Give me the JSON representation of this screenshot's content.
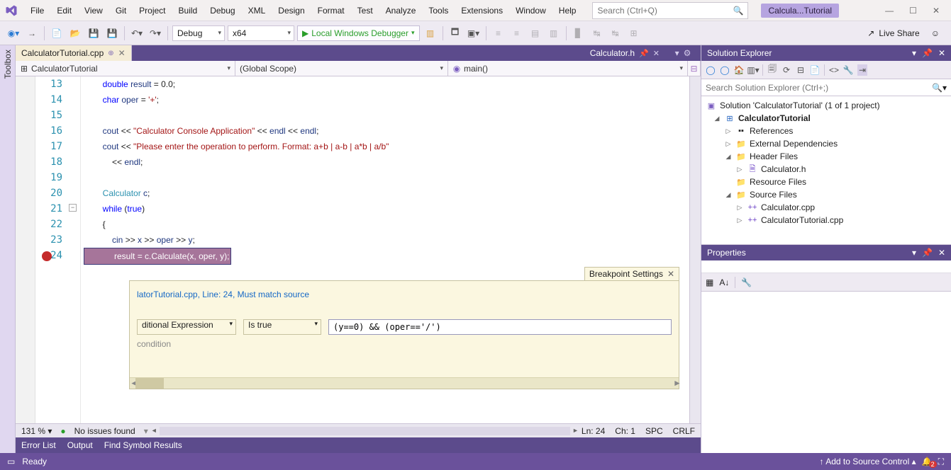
{
  "menu": [
    "File",
    "Edit",
    "View",
    "Git",
    "Project",
    "Build",
    "Debug",
    "XML",
    "Design",
    "Format",
    "Test",
    "Analyze",
    "Tools",
    "Extensions",
    "Window",
    "Help"
  ],
  "search": {
    "placeholder": "Search (Ctrl+Q)"
  },
  "title_badge": "Calcula...Tutorial",
  "toolbar": {
    "config": "Debug",
    "platform": "x64",
    "debugger": "Local Windows Debugger",
    "live_share": "Live Share"
  },
  "toolbox_label": "Toolbox",
  "tabs": {
    "active": "CalculatorTutorial.cpp",
    "preview": "Calculator.h"
  },
  "navbar": {
    "project": "CalculatorTutorial",
    "scope": "(Global Scope)",
    "func": "main()"
  },
  "line_start": 13,
  "code_lines": [
    {
      "n": 13,
      "html": "        <span class='kw'>double</span> <span class='var'>result</span> = 0.0;"
    },
    {
      "n": 14,
      "html": "        <span class='kw'>char</span> <span class='var'>oper</span> = <span class='str'>'+'</span>;"
    },
    {
      "n": 15,
      "html": ""
    },
    {
      "n": 16,
      "html": "        <span class='var'>cout</span> &lt;&lt; <span class='str'>\"Calculator Console Application\"</span> &lt;&lt; <span class='var'>endl</span> &lt;&lt; <span class='var'>endl</span>;"
    },
    {
      "n": 17,
      "html": "        <span class='var'>cout</span> &lt;&lt; <span class='str'>\"Please enter the operation to perform. Format: a+b | a-b | a*b | a/b\"</span>"
    },
    {
      "n": 18,
      "html": "            &lt;&lt; <span class='var'>endl</span>;"
    },
    {
      "n": 19,
      "html": ""
    },
    {
      "n": 20,
      "html": "        <span class='type'>Calculator</span> <span class='var'>c</span>;"
    },
    {
      "n": 21,
      "html": "        <span class='kw'>while</span> (<span class='kw'>true</span>)"
    },
    {
      "n": 22,
      "html": "        {"
    },
    {
      "n": 23,
      "html": "            <span class='var'>cin</span> &gt;&gt; <span class='var'>x</span> &gt;&gt; <span class='var'>oper</span> &gt;&gt; <span class='var'>y</span>;"
    },
    {
      "n": 24,
      "html": "<span class='hl-line'>            <span class='var'>result</span> = <span class='var'>c</span>.<span class='fn'>Calculate</span>(<span class='var'>x</span>, <span class='var'>oper</span>, <span class='var'>y</span>);</span>",
      "bp": true
    }
  ],
  "bp": {
    "title": "Breakpoint Settings",
    "location": "latorTutorial.cpp, Line: 24, Must match source",
    "cond_type": "ditional Expression",
    "cond_eval": "Is true",
    "cond_expr": "(y==0) && (oper=='/')",
    "cond_label": "condition"
  },
  "editor_status": {
    "zoom": "131 %",
    "issues": "No issues found",
    "ln": "Ln: 24",
    "ch": "Ch: 1",
    "spc": "SPC",
    "crlf": "CRLF"
  },
  "bottom_tabs": [
    "Error List",
    "Output",
    "Find Symbol Results"
  ],
  "solution": {
    "title": "Solution Explorer",
    "search_placeholder": "Search Solution Explorer (Ctrl+;)",
    "root": "Solution 'CalculatorTutorial' (1 of 1 project)",
    "project": "CalculatorTutorial",
    "nodes": {
      "references": "References",
      "external": "External Dependencies",
      "headers": "Header Files",
      "calculator_h": "Calculator.h",
      "resources": "Resource Files",
      "sources": "Source Files",
      "calculator_cpp": "Calculator.cpp",
      "tutorial_cpp": "CalculatorTutorial.cpp"
    }
  },
  "properties": {
    "title": "Properties"
  },
  "status": {
    "ready": "Ready",
    "source_control": "Add to Source Control",
    "notif_count": "2"
  }
}
